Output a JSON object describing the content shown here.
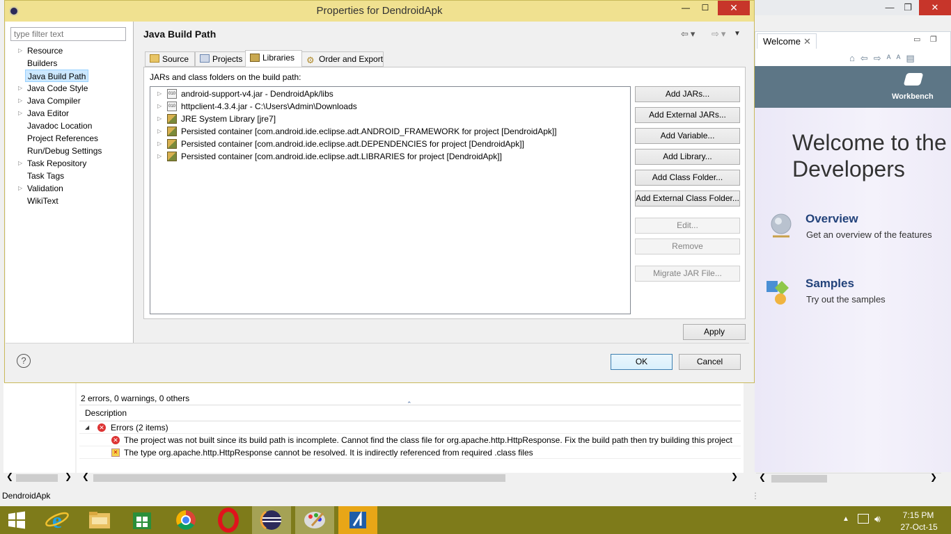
{
  "dialog": {
    "title": "Properties for DendroidApk",
    "min": "—",
    "max": "☐",
    "close": "✕",
    "filter_placeholder": "type filter text",
    "nav_items": [
      {
        "label": "Resource",
        "expandable": true
      },
      {
        "label": "Builders",
        "expandable": false
      },
      {
        "label": "Java Build Path",
        "expandable": false,
        "selected": true
      },
      {
        "label": "Java Code Style",
        "expandable": true
      },
      {
        "label": "Java Compiler",
        "expandable": true
      },
      {
        "label": "Java Editor",
        "expandable": true
      },
      {
        "label": "Javadoc Location",
        "expandable": false
      },
      {
        "label": "Project References",
        "expandable": false
      },
      {
        "label": "Run/Debug Settings",
        "expandable": false
      },
      {
        "label": "Task Repository",
        "expandable": true
      },
      {
        "label": "Task Tags",
        "expandable": false
      },
      {
        "label": "Validation",
        "expandable": true
      },
      {
        "label": "WikiText",
        "expandable": false
      }
    ],
    "page_title": "Java Build Path",
    "tabs": [
      {
        "label": "Source",
        "active": false
      },
      {
        "label": "Projects",
        "active": false
      },
      {
        "label": "Libraries",
        "active": true
      },
      {
        "label": "Order and Export",
        "active": false
      }
    ],
    "panel_label": "JARs and class folders on the build path:",
    "entries": [
      {
        "text": "android-support-v4.jar - DendroidApk/libs",
        "icon": "jar-icon"
      },
      {
        "text": "httpclient-4.3.4.jar - C:\\Users\\Admin\\Downloads",
        "icon": "jar-icon"
      },
      {
        "text": "JRE System Library [jre7]",
        "icon": "library-icon"
      },
      {
        "text": "Persisted container [com.android.ide.eclipse.adt.ANDROID_FRAMEWORK for project [DendroidApk]]",
        "icon": "library-icon"
      },
      {
        "text": "Persisted container [com.android.ide.eclipse.adt.DEPENDENCIES for project [DendroidApk]]",
        "icon": "library-icon"
      },
      {
        "text": "Persisted container [com.android.ide.eclipse.adt.LIBRARIES for project [DendroidApk]]",
        "icon": "library-icon"
      }
    ],
    "buttons": {
      "add_jars": "Add JARs...",
      "add_external_jars": "Add External JARs...",
      "add_variable": "Add Variable...",
      "add_library": "Add Library...",
      "add_class_folder": "Add Class Folder...",
      "add_external_class_folder": "Add External Class Folder...",
      "edit": "Edit...",
      "remove": "Remove",
      "migrate": "Migrate JAR File...",
      "apply": "Apply",
      "ok": "OK",
      "cancel": "Cancel"
    },
    "help": "?"
  },
  "problems": {
    "summary": "2 errors, 0 warnings, 0 others",
    "column": "Description",
    "group": "Errors (2 items)",
    "items": [
      "The project was not built since its build path is incomplete. Cannot find the class file for org.apache.http.HttpResponse. Fix the build path then try building this project",
      "The type org.apache.http.HttpResponse cannot be resolved. It is indirectly referenced from required .class files"
    ]
  },
  "welcome": {
    "tab": "Welcome",
    "workbench": "Workbench",
    "heading": "Welcome to the\nDevelopers",
    "overview_title": "Overview",
    "overview_desc": "Get an overview of the features",
    "samples_title": "Samples",
    "samples_desc": "Try out the samples"
  },
  "status": {
    "project": "DendroidApk"
  },
  "taskbar": {
    "time": "7:15 PM",
    "date": "27-Oct-15"
  },
  "colors": {
    "dialog_title": "#f0e190",
    "taskbar": "#7e7b1a",
    "close": "#c7352a"
  }
}
